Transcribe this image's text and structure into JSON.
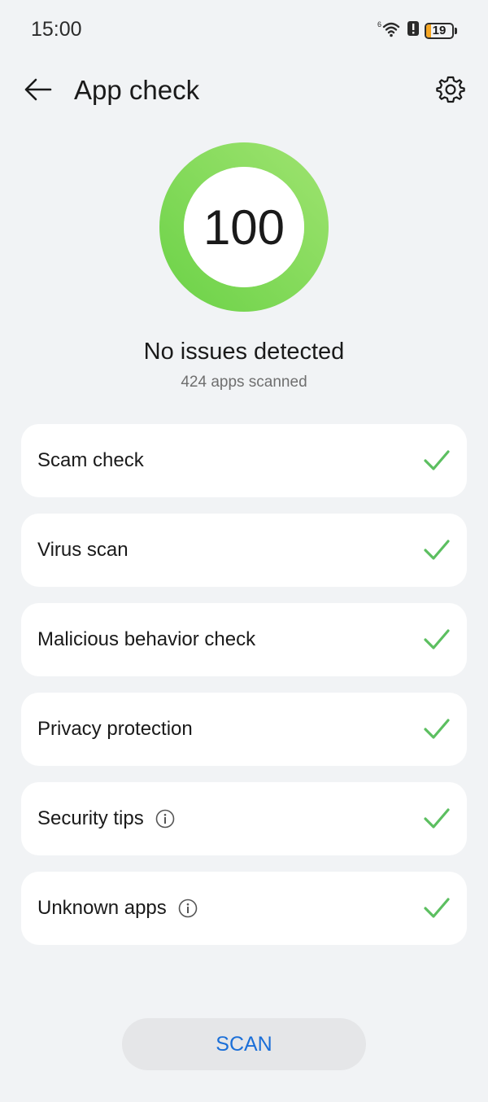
{
  "status_bar": {
    "time": "15:00",
    "network_label": "6",
    "battery_level": "19",
    "battery_color": "#f5a623"
  },
  "header": {
    "title": "App check",
    "back_icon": "arrow-left-icon",
    "settings_icon": "gear-icon"
  },
  "score": {
    "value": "100",
    "progress_fraction": 1.0,
    "ring_color": "#7ed957"
  },
  "summary": {
    "title": "No issues detected",
    "subtitle": "424 apps scanned"
  },
  "checks": [
    {
      "label": "Scam check",
      "has_info": false,
      "status_icon": "checkmark-icon"
    },
    {
      "label": "Virus scan",
      "has_info": false,
      "status_icon": "checkmark-icon"
    },
    {
      "label": "Malicious behavior check",
      "has_info": false,
      "status_icon": "checkmark-icon"
    },
    {
      "label": "Privacy protection",
      "has_info": false,
      "status_icon": "checkmark-icon"
    },
    {
      "label": "Security tips",
      "has_info": true,
      "status_icon": "checkmark-icon"
    },
    {
      "label": "Unknown apps",
      "has_info": true,
      "status_icon": "checkmark-icon"
    }
  ],
  "scan_button": {
    "label": "SCAN",
    "color": "#1b6fd8"
  },
  "colors": {
    "background": "#f1f3f5",
    "check_green": "#5cbf60"
  }
}
